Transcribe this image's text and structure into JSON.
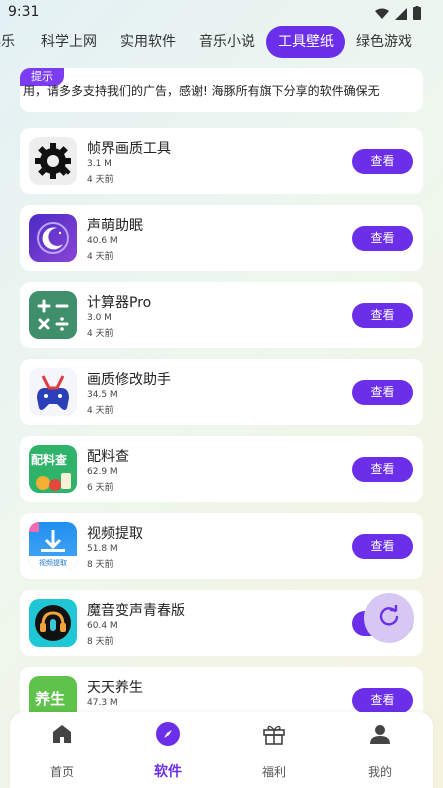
{
  "status_bar": {
    "time": "9:31"
  },
  "tabs": [
    {
      "label": "娱乐",
      "active": false
    },
    {
      "label": "科学上网",
      "active": false
    },
    {
      "label": "实用软件",
      "active": false
    },
    {
      "label": "音乐小说",
      "active": false
    },
    {
      "label": "工具壁纸",
      "active": true
    },
    {
      "label": "绿色游戏",
      "active": false
    }
  ],
  "notice": {
    "tag": "提示",
    "text": "用，请多多支持我们的广告，感谢!    海豚所有旗下分享的软件确保无"
  },
  "apps": [
    {
      "name": "帧界画质工具",
      "size": "3.1 M",
      "time": "4 天前",
      "button": "查看",
      "icon": "gear-icon"
    },
    {
      "name": "声萌助眠",
      "size": "40.6 M",
      "time": "4 天前",
      "button": "查看",
      "icon": "moon-icon"
    },
    {
      "name": "计算器Pro",
      "size": "3.0 M",
      "time": "4 天前",
      "button": "查看",
      "icon": "calculator-icon"
    },
    {
      "name": "画质修改助手",
      "size": "34.5 M",
      "time": "4 天前",
      "button": "查看",
      "icon": "gamepad-icon"
    },
    {
      "name": "配料查",
      "size": "62.9 M",
      "time": "6 天前",
      "button": "查看",
      "icon": "ingredients-icon",
      "icon_text": "配料查"
    },
    {
      "name": "视频提取",
      "size": "51.8 M",
      "time": "8 天前",
      "button": "查看",
      "icon": "download-icon",
      "icon_text": "视频提取"
    },
    {
      "name": "魔音变声青春版",
      "size": "60.4 M",
      "time": "8 天前",
      "button": "查看",
      "icon": "headset-icon"
    },
    {
      "name": "天天养生",
      "size": "47.3 M",
      "time": "",
      "button": "查看",
      "icon": "health-icon",
      "icon_text": "养生"
    }
  ],
  "fab": {
    "icon": "refresh-icon"
  },
  "bottom_nav": [
    {
      "label": "首页",
      "icon": "home-icon",
      "active": false
    },
    {
      "label": "软件",
      "icon": "compass-icon",
      "active": true
    },
    {
      "label": "福利",
      "icon": "gift-icon",
      "active": false
    },
    {
      "label": "我的",
      "icon": "user-icon",
      "active": false
    }
  ],
  "colors": {
    "accent": "#6b2fea",
    "fab": "#d6c8f3"
  }
}
